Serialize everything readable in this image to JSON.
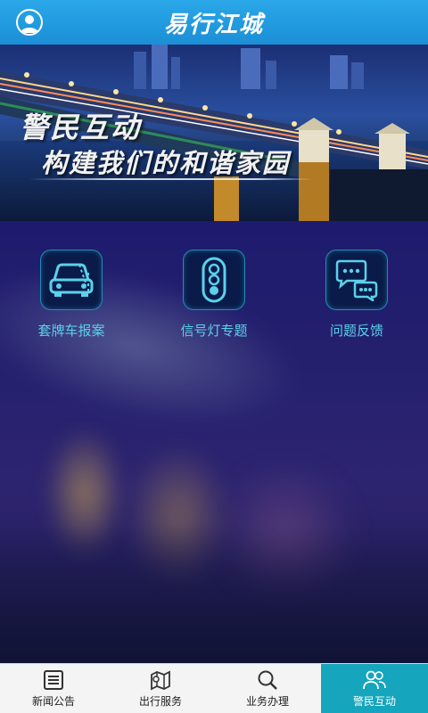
{
  "header": {
    "title": "易行江城",
    "avatar_icon": "user-circle-icon"
  },
  "banner": {
    "headline": "警民互动",
    "subline": "构建我们的和谐家园"
  },
  "features": [
    {
      "label": "套牌车报案",
      "icon": "car-icon"
    },
    {
      "label": "信号灯专题",
      "icon": "traffic-light-icon"
    },
    {
      "label": "问题反馈",
      "icon": "chat-bubbles-icon"
    }
  ],
  "bottom_nav": [
    {
      "label": "新闻公告",
      "icon": "news-list-icon",
      "active": false
    },
    {
      "label": "出行服务",
      "icon": "map-pin-icon",
      "active": false
    },
    {
      "label": "业务办理",
      "icon": "search-icon",
      "active": false
    },
    {
      "label": "警民互动",
      "icon": "people-icon",
      "active": true
    }
  ],
  "colors": {
    "header_blue": "#1b8fd6",
    "accent_cyan": "#5bd1ea",
    "active_tab": "#15a5bd"
  }
}
